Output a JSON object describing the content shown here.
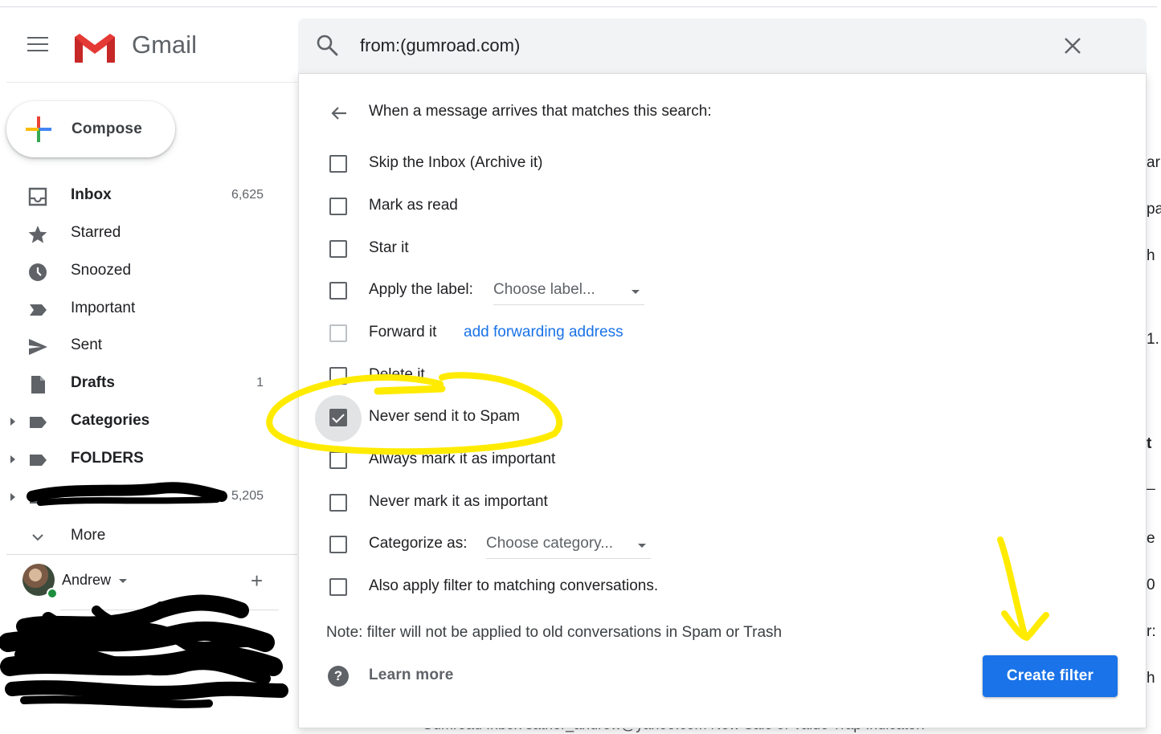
{
  "app": {
    "logo_text": "Gmail",
    "icons": {
      "menu": "hamburger-icon",
      "logo": "gmail-logo",
      "search": "search-icon",
      "close": "close-icon"
    }
  },
  "search": {
    "value": "from:(gumroad.com)"
  },
  "compose": {
    "label": "Compose"
  },
  "sidebar": {
    "items": [
      {
        "label": "Inbox",
        "count": "6,625",
        "icon": "inbox-icon",
        "bold": true
      },
      {
        "label": "Starred",
        "count": "",
        "icon": "star-icon",
        "bold": false
      },
      {
        "label": "Snoozed",
        "count": "",
        "icon": "clock-icon",
        "bold": false
      },
      {
        "label": "Important",
        "count": "",
        "icon": "important-icon",
        "bold": false
      },
      {
        "label": "Sent",
        "count": "",
        "icon": "send-icon",
        "bold": false
      },
      {
        "label": "Drafts",
        "count": "1",
        "icon": "draft-icon",
        "bold": true
      },
      {
        "label": "Categories",
        "count": "",
        "icon": "label-icon",
        "bold": true
      },
      {
        "label": "FOLDERS",
        "count": "",
        "icon": "label-icon",
        "bold": true
      },
      {
        "label": "",
        "count": "5,205",
        "icon": "label-icon",
        "bold": false,
        "redacted": true
      }
    ],
    "more_label": "More"
  },
  "hangouts": {
    "user": "Andrew",
    "status": "online"
  },
  "filter": {
    "heading": "When a message arrives that matches this search:",
    "options": [
      {
        "label": "Skip the Inbox (Archive it)",
        "checked": false
      },
      {
        "label": "Mark as read",
        "checked": false
      },
      {
        "label": "Star it",
        "checked": false
      },
      {
        "label": "Apply the label:",
        "checked": false,
        "dropdown": "Choose label..."
      },
      {
        "label": "Forward it",
        "checked": false,
        "disabled": true,
        "link": "add forwarding address"
      },
      {
        "label": "Delete it",
        "checked": false
      },
      {
        "label": "Never send it to Spam",
        "checked": true
      },
      {
        "label": "Always mark it as important",
        "checked": false
      },
      {
        "label": "Never mark it as important",
        "checked": false
      },
      {
        "label": "Categorize as:",
        "checked": false,
        "dropdown": "Choose category..."
      },
      {
        "label": "Also apply filter to matching conversations.",
        "checked": false
      }
    ],
    "note": "Note: filter will not be applied to old conversations in Spam or Trash",
    "learn_more": "Learn more",
    "create_button": "Create filter"
  },
  "background": {
    "peek_chars": [
      "ar",
      "pa",
      "h",
      "1.",
      "t",
      "_",
      "e",
      "0",
      "r:",
      "h"
    ],
    "bottom_row": "Gumroad      Inbox   sather_andrew@yahoo.com   New Sale of Value Trap Indicator!"
  },
  "colors": {
    "primary": "#1a73e8",
    "annotation": "#ffeb00",
    "text": "#202124",
    "icon": "#5f6368"
  }
}
